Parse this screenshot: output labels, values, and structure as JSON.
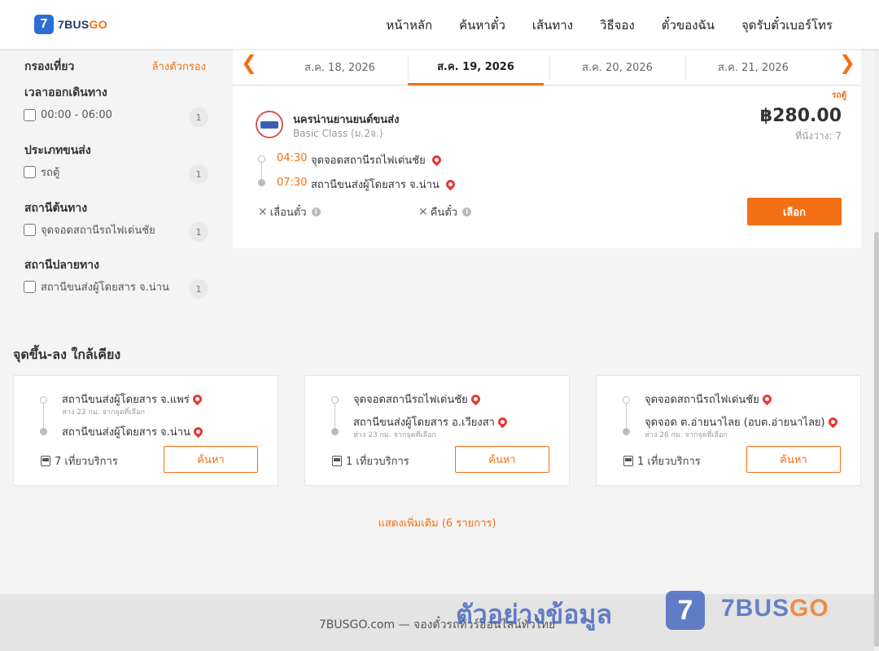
{
  "header": {
    "logo_text": "7BUS",
    "logo_text_accent": "GO",
    "logo_mark": "7",
    "nav": [
      "หน้าหลัก",
      "ค้นหาตั๋ว",
      "เส้นทาง",
      "วิธีจอง",
      "ตั๋วของฉัน",
      "จุดรับตั๋วเบอร์โทร"
    ]
  },
  "filter": {
    "title": "กรองเที่ยว",
    "clear": "ล้างตัวกรอง",
    "groups": [
      {
        "title": "เวลาออกเดินทาง",
        "option": "00:00 - 06:00",
        "count": "1"
      },
      {
        "title": "ประเภทขนส่ง",
        "option": "รถตู้",
        "count": "1"
      },
      {
        "title": "สถานีต้นทาง",
        "option": "จุดจอดสถานีรถไฟเด่นชัย",
        "count": "1"
      },
      {
        "title": "สถานีปลายทาง",
        "option": "สถานีขนส่งผู้โดยสาร จ.น่าน",
        "count": "1"
      }
    ]
  },
  "dates": {
    "prev_icon": "chevron-left-icon",
    "next_icon": "chevron-right-icon",
    "tabs": [
      "ส.ค. 18, 2026",
      "ส.ค. 19, 2026",
      "ส.ค. 20, 2026",
      "ส.ค. 21, 2026"
    ],
    "active_index": 1
  },
  "trip": {
    "vehicle_type": "รถตู้",
    "operator": "นครน่านยานยนต์ขนส่ง",
    "class": "Basic Class (ม.2จ.)",
    "price": "฿280.00",
    "seats": "ที่นั่งว่าง: 7",
    "depart_time": "04:30",
    "depart_stop": "จุดจอดสถานีรถไฟเด่นชัย",
    "arrive_time": "07:30",
    "arrive_stop": "สถานีขนส่งผู้โดยสาร จ.น่าน",
    "reschedule": "เลื่อนตั๋ว",
    "refund": "คืนตั๋ว",
    "select_label": "เลือก"
  },
  "nearby": {
    "title": "จุดขึ้น-ลง ใกล้เคียง",
    "cards": [
      {
        "from": "สถานีขนส่งผู้โดยสาร จ.แพร่",
        "from_dist": "ห่าง 22 กม. จากจุดที่เลือก",
        "to": "สถานีขนส่งผู้โดยสาร จ.น่าน",
        "to_dist": "",
        "trips": "7 เที่ยวบริการ",
        "button": "ค้นหา"
      },
      {
        "from": "จุดจอดสถานีรถไฟเด่นชัย",
        "from_dist": "",
        "to": "สถานีขนส่งผู้โดยสาร อ.เวียงสา",
        "to_dist": "ห่าง 23 กม. จากจุดที่เลือก",
        "trips": "1 เที่ยวบริการ",
        "button": "ค้นหา"
      },
      {
        "from": "จุดจอดสถานีรถไฟเด่นชัย",
        "from_dist": "",
        "to": "จุดจอด ต.อ่ายนาไลย (อบต.อ่ายนาไลย)",
        "to_dist": "ห่าง 26 กม. จากจุดที่เลือก",
        "trips": "1 เที่ยวบริการ",
        "button": "ค้นหา"
      }
    ],
    "show_more": "แสดงเพิ่มเติม (6 รายการ)"
  },
  "footer": {
    "text": "7BUSGO.com — จองตั๋วรถทัวร์ออนไลน์ทั่วไทย"
  },
  "watermark": {
    "text": "ตัวอย่างข้อมูล",
    "logo_mark": "7",
    "logo_text": "7BUS",
    "logo_text_accent": "GO"
  },
  "colors": {
    "accent": "#f36f13",
    "brand_blue": "#2b6fd6",
    "pin_red": "#e53935"
  }
}
